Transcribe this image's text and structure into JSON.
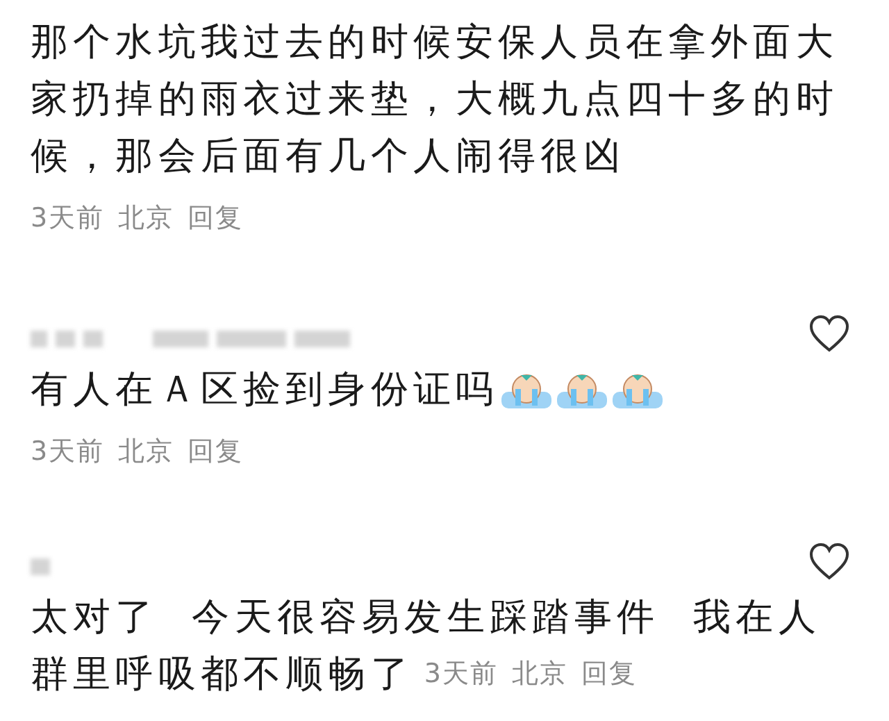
{
  "comments": [
    {
      "author_hidden": false,
      "lines": [
        "那个水坑我过去的时候安保人员在拿外面大",
        "家扔掉的雨衣过来垫，大概九点四十多的时",
        "候，那会后面有几个人闹得很凶"
      ],
      "meta_inline": false,
      "time": "3天前",
      "location": "北京",
      "reply": "回复"
    },
    {
      "author_hidden": true,
      "liked": false,
      "lines": [
        "有人在Ａ区捡到身份证吗"
      ],
      "emojis": [
        {
          "kind": "crying"
        },
        {
          "kind": "crying"
        },
        {
          "kind": "crying"
        }
      ],
      "meta_inline": false,
      "time": "3天前",
      "location": "北京",
      "reply": "回复"
    },
    {
      "author_hidden": true,
      "liked": false,
      "lines": [
        "太对了  今天很容易发生踩踏事件  我在人",
        "群里呼吸都不顺畅了"
      ],
      "meta_inline": true,
      "time": "3天前",
      "location": "北京",
      "reply": "回复"
    }
  ]
}
